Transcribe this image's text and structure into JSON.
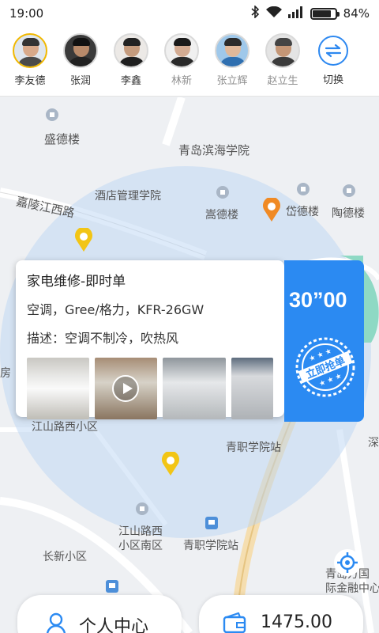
{
  "status_bar": {
    "time": "19:00",
    "battery": "84%"
  },
  "staff": [
    {
      "name": "李友德",
      "active": true
    },
    {
      "name": "张润",
      "active": false
    },
    {
      "name": "李鑫",
      "active": false
    },
    {
      "name": "林新",
      "active": false
    },
    {
      "name": "张立辉",
      "active": false
    },
    {
      "name": "赵立生",
      "active": false
    }
  ],
  "switch_label": "切换",
  "map": {
    "labels": {
      "shengde": "盛德楼",
      "college": "青岛滨海学院",
      "hotel_school": "酒店管理学院",
      "songde": "嵩德楼",
      "daide": "岱德楼",
      "taode": "陶德楼",
      "jialing": "嘉陵江西路",
      "xuanxiaoqu": "江山路西小区",
      "qingzhi1": "青职学院站",
      "jiangshan_nan1": "江山路西",
      "jiangshan_nan2": "小区南区",
      "qingzhi2": "青职学院站",
      "changxin": "长新小区",
      "fang": "房",
      "jiang": "江",
      "shen": "深",
      "gaoling": "嘉陵",
      "road_bei": "路",
      "intl1": "青岛方国",
      "intl2": "际金融中心"
    }
  },
  "order": {
    "title": "家电维修-即时单",
    "product": "空调，Gree/格力，KFR-26GW",
    "description": "描述：空调不制冷，吹热风",
    "countdown": "30”00",
    "grab_label": "立即抢单"
  },
  "bottom": {
    "profile_label": "个人中心",
    "wallet_amount": "1475.00"
  }
}
